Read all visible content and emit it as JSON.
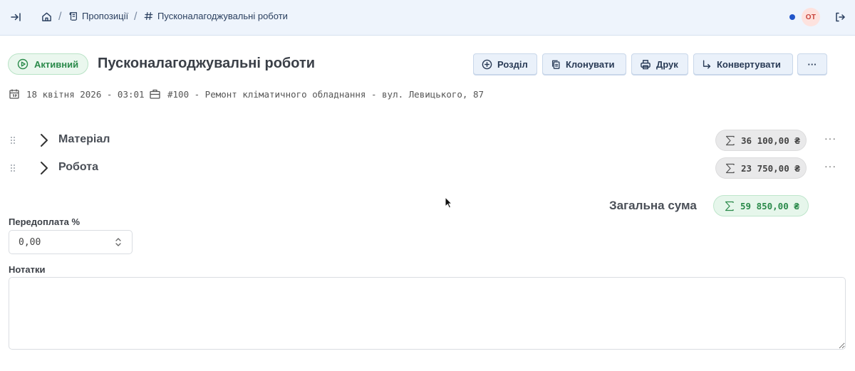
{
  "topbar": {
    "breadcrumb": [
      {
        "label": "Пропозиції"
      },
      {
        "label": "Пусконалагоджувальні роботи"
      }
    ],
    "separator": "/",
    "avatar_initials": "ОТ"
  },
  "header": {
    "status": "Активний",
    "title": "Пусконалагоджувальні роботи",
    "actions": {
      "section": "Розділ",
      "clone": "Клонувати",
      "print": "Друк",
      "convert": "Конвертувати",
      "more": "···"
    }
  },
  "meta": {
    "date": "18 квітня 2026 - 03:01",
    "project": "#100 - Ремонт кліматичного обладнання - вул. Левицького, 87"
  },
  "sections": [
    {
      "label": "Матеріал",
      "total": "36 100,00 ₴"
    },
    {
      "label": "Робота",
      "total": "23 750,00 ₴"
    }
  ],
  "row_more": "···",
  "total": {
    "label": "Загальна сума",
    "value": "59 850,00 ₴"
  },
  "prepayment": {
    "label": "Передоплата %",
    "value": "0,00"
  },
  "notes": {
    "label": "Нотатки",
    "value": ""
  },
  "colors": {
    "accent": "#2155c9",
    "active_green": "#2a8a4a",
    "topbar_bg": "#eef4fc"
  },
  "icons": [
    "sidebar-expand-icon",
    "home-icon",
    "scroll-icon",
    "hash-icon",
    "logout-icon",
    "play-circle-icon",
    "plus-circle-icon",
    "copy-icon",
    "printer-icon",
    "arrow-turn-icon",
    "calendar-icon",
    "briefcase-icon",
    "drag-icon",
    "chevron-right-icon",
    "sigma-icon",
    "stepper-icon",
    "cursor-icon"
  ]
}
